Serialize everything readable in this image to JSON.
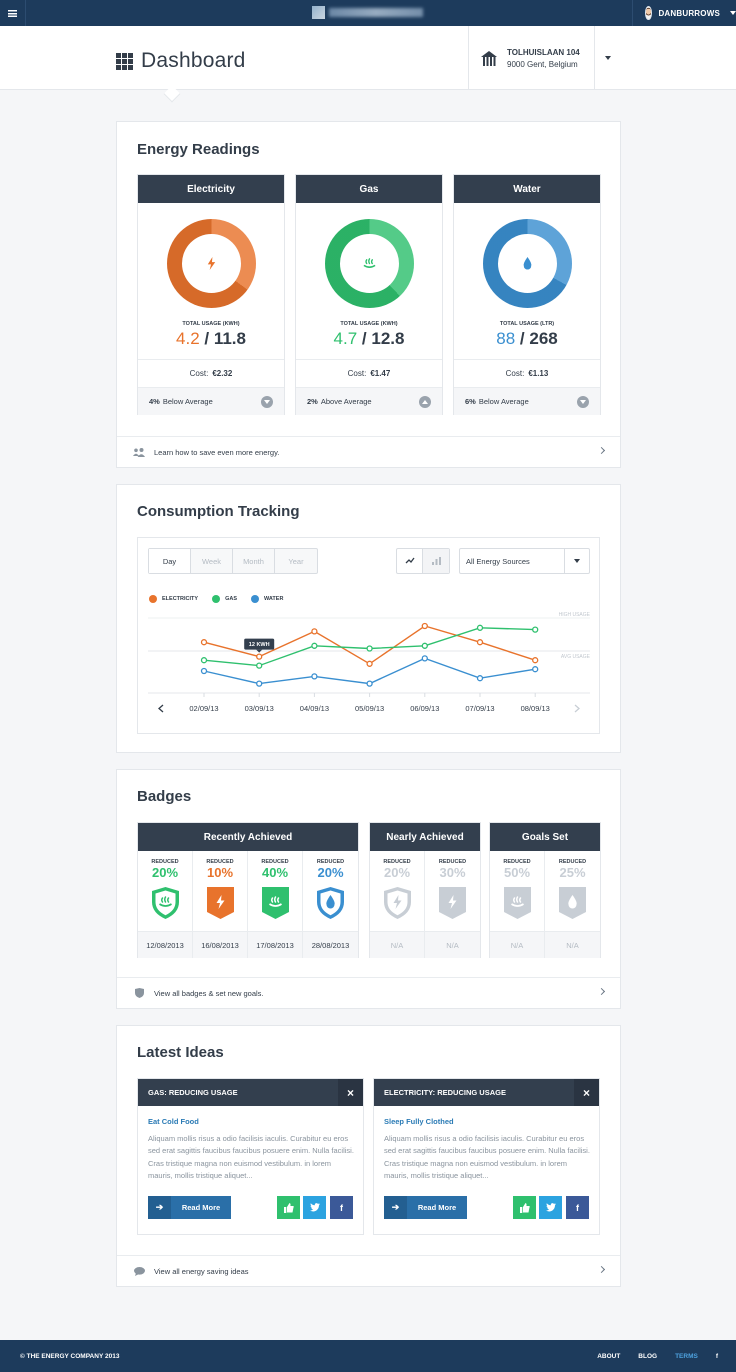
{
  "topbar": {
    "menu_icon": "hamburger-icon",
    "username": "DANBURROWS"
  },
  "header": {
    "title": "Dashboard",
    "address_line1": "TOLHUISLAAN 104",
    "address_line2": "9000 Gent, Belgium"
  },
  "energy": {
    "title": "Energy Readings",
    "cards": [
      {
        "name": "Electricity",
        "color": "#e8732c",
        "ring_fill": 0.35,
        "usage_label": "TOTAL USAGE (KWH)",
        "used": "4.2",
        "total": "11.8",
        "cost_label": "Cost:",
        "cost": "€2.32",
        "avg_value": "4%",
        "avg_text": "Below Average",
        "icon": "lightning-icon",
        "trend": "down"
      },
      {
        "name": "Gas",
        "color": "#2fc06e",
        "ring_fill": 0.38,
        "usage_label": "TOTAL USAGE (KWH)",
        "used": "4.7",
        "total": "12.8",
        "cost_label": "Cost:",
        "cost": "€1.47",
        "avg_value": "2%",
        "avg_text": "Above Average",
        "icon": "flame-icon",
        "trend": "up"
      },
      {
        "name": "Water",
        "color": "#3a8fd0",
        "ring_fill": 0.33,
        "usage_label": "TOTAL USAGE (LTR)",
        "used": "88",
        "total": "268",
        "cost_label": "Cost:",
        "cost": "€1.13",
        "avg_value": "6%",
        "avg_text": "Below Average",
        "icon": "water-drop-icon",
        "trend": "down"
      }
    ],
    "footer": "Learn how to save even more energy."
  },
  "consumption": {
    "title": "Consumption Tracking",
    "tabs": [
      "Day",
      "Week",
      "Month",
      "Year"
    ],
    "active_tab": "Day",
    "source_select": "All Energy Sources",
    "legend": [
      "ELECTRICITY",
      "GAS",
      "WATER"
    ],
    "high_label": "HIGH USAGE",
    "avg_label": "AVG USAGE",
    "tooltip": "12 KWH"
  },
  "chart_data": {
    "type": "line",
    "x": [
      "02/09/13",
      "03/09/13",
      "04/09/13",
      "05/09/13",
      "06/09/13",
      "07/09/13",
      "08/09/13"
    ],
    "series": [
      {
        "name": "ELECTRICITY",
        "color": "#e8732c",
        "values": [
          12.2,
          10.6,
          13.4,
          9.8,
          14.0,
          12.2,
          10.2
        ]
      },
      {
        "name": "GAS",
        "color": "#2fc06e",
        "values": [
          10.2,
          9.6,
          11.8,
          11.5,
          11.8,
          13.8,
          13.6
        ]
      },
      {
        "name": "WATER",
        "color": "#3a8fd0",
        "values": [
          9.0,
          7.6,
          8.4,
          7.6,
          10.4,
          8.2,
          9.2
        ]
      }
    ],
    "ylim": [
      5,
      16
    ]
  },
  "badges": {
    "title": "Badges",
    "groups": [
      {
        "name": "Recently Achieved",
        "items": [
          {
            "label": "REDUCED",
            "pct": "20%",
            "color": "#2fc06e",
            "shape": "shield",
            "icon": "flame-icon",
            "date": "12/08/2013"
          },
          {
            "label": "REDUCED",
            "pct": "10%",
            "color": "#e8732c",
            "shape": "ribbon",
            "icon": "lightning-icon",
            "date": "16/08/2013"
          },
          {
            "label": "REDUCED",
            "pct": "40%",
            "color": "#2fc06e",
            "shape": "ribbon",
            "icon": "flame-icon",
            "date": "17/08/2013"
          },
          {
            "label": "REDUCED",
            "pct": "20%",
            "color": "#3a8fd0",
            "shape": "shield",
            "icon": "water-drop-icon",
            "date": "28/08/2013"
          }
        ]
      },
      {
        "name": "Nearly Achieved",
        "items": [
          {
            "label": "REDUCED",
            "pct": "20%",
            "color": "#c8ced5",
            "shape": "shield",
            "icon": "lightning-icon",
            "date": "N/A"
          },
          {
            "label": "REDUCED",
            "pct": "30%",
            "color": "#c8ced5",
            "shape": "ribbon",
            "icon": "lightning-icon",
            "date": "N/A"
          }
        ]
      },
      {
        "name": "Goals Set",
        "items": [
          {
            "label": "REDUCED",
            "pct": "50%",
            "color": "#c8ced5",
            "shape": "ribbon",
            "icon": "flame-icon",
            "date": "N/A"
          },
          {
            "label": "REDUCED",
            "pct": "25%",
            "color": "#c8ced5",
            "shape": "ribbon",
            "icon": "water-drop-icon",
            "date": "N/A"
          }
        ]
      }
    ],
    "footer": "View all badges & set new goals."
  },
  "ideas": {
    "title": "Latest Ideas",
    "cards": [
      {
        "header": "GAS: REDUCING USAGE",
        "title": "Eat Cold Food",
        "body": "Aliquam mollis risus a odio facilisis iaculis. Curabitur eu eros sed erat sagittis faucibus faucibus posuere enim. Nulla facilisi. Cras tristique magna non euismod vestibulum. in lorem mauris, mollis tristique aliquet...",
        "button": "Read More"
      },
      {
        "header": "ELECTRICITY: REDUCING USAGE",
        "title": "Sleep Fully Clothed",
        "body": "Aliquam mollis risus a odio facilisis iaculis. Curabitur eu eros sed erat sagittis faucibus faucibus posuere enim. Nulla facilisi. Cras tristique magna non euismod vestibulum. in lorem mauris, mollis tristique aliquet...",
        "button": "Read More"
      }
    ],
    "close": "×",
    "footer": "View all energy saving ideas"
  },
  "footer": {
    "copyright": "© THE ENERGY COMPANY 2013",
    "links": [
      "ABOUT",
      "BLOG",
      "TERMS"
    ],
    "facebook": "f"
  },
  "colors": {
    "navy": "#1d3b5c",
    "header_dark": "#333f4e",
    "green": "#2fc06e",
    "orange": "#e8732c",
    "blue": "#3a8fd0",
    "twitter": "#2ca3e0",
    "facebook": "#3b5998"
  }
}
